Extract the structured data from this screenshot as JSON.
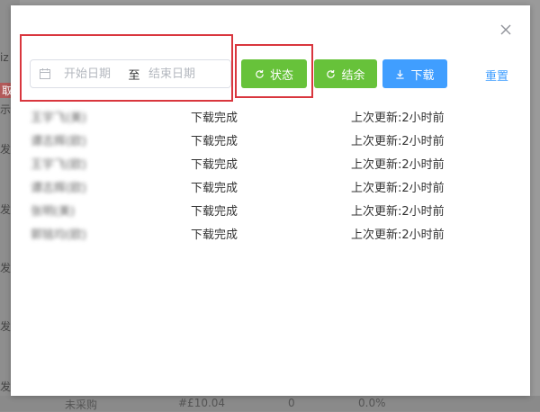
{
  "dialog": {
    "date_start_placeholder": "开始日期",
    "date_end_placeholder": "结束日期",
    "date_separator": "至",
    "buttons": {
      "status": "状态",
      "settle": "结余",
      "download": "下载",
      "reset": "重置"
    },
    "rows": [
      {
        "name": "王宇飞(美)",
        "status": "下载完成",
        "updated": "上次更新:2小时前"
      },
      {
        "name": "谭志辉(欧)",
        "status": "下载完成",
        "updated": "上次更新:2小时前"
      },
      {
        "name": "王宇飞(欧)",
        "status": "下载完成",
        "updated": "上次更新:2小时前"
      },
      {
        "name": "谭志辉(欧)",
        "status": "下载完成",
        "updated": "上次更新:2小时前"
      },
      {
        "name": "张明(美)",
        "status": "下载完成",
        "updated": "上次更新:2小时前"
      },
      {
        "name": "郭铭均(欧)",
        "status": "下载完成",
        "updated": "上次更新:2小时前"
      }
    ]
  },
  "background": {
    "fragments": [
      "iz",
      "取",
      "示",
      "发",
      "发",
      "发",
      "发",
      "发"
    ],
    "bottom_row": {
      "status": "未采购",
      "price": "#£10.04",
      "count": "0",
      "percent": "0.0%"
    }
  },
  "colors": {
    "green": "#67c23a",
    "blue": "#409eff",
    "highlight_red": "#d9363e"
  }
}
